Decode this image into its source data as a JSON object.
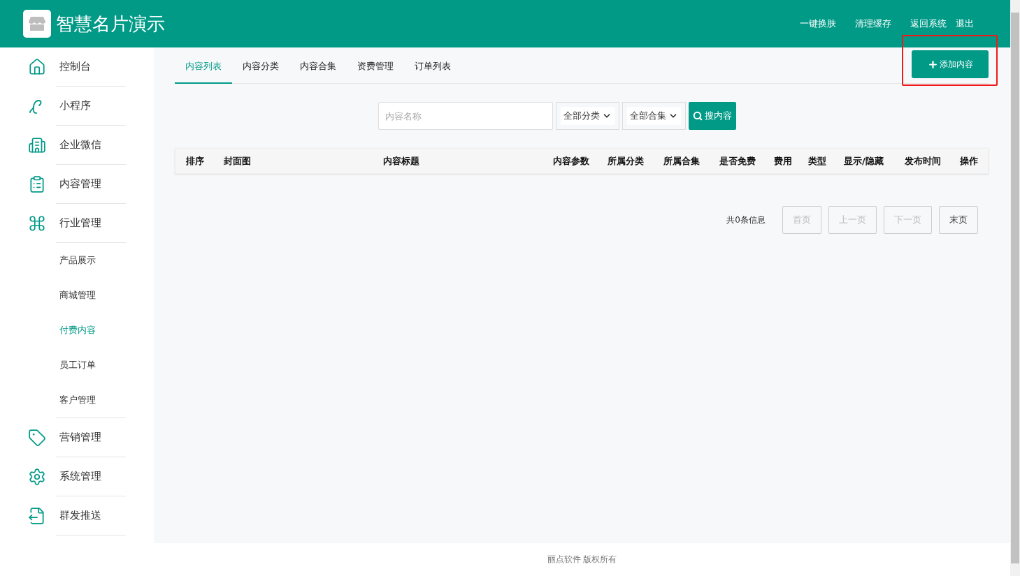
{
  "header": {
    "title": "智慧名片演示",
    "links": [
      "一键换肤",
      "清理缓存",
      "返回系统",
      "退出"
    ]
  },
  "sidebar": {
    "items": [
      {
        "label": "控制台",
        "selected": false
      },
      {
        "label": "小程序",
        "selected": false
      },
      {
        "label": "企业微信",
        "selected": false
      },
      {
        "label": "内容管理",
        "selected": false
      },
      {
        "label": "行业管理",
        "selected": false,
        "children": [
          {
            "label": "产品展示",
            "selected": false
          },
          {
            "label": "商城管理",
            "selected": false
          },
          {
            "label": "付费内容",
            "selected": true
          },
          {
            "label": "员工订单",
            "selected": false
          },
          {
            "label": "客户管理",
            "selected": false
          }
        ]
      },
      {
        "label": "营销管理",
        "selected": false
      },
      {
        "label": "系统管理",
        "selected": false
      },
      {
        "label": "群发推送",
        "selected": false
      }
    ]
  },
  "tabs": [
    {
      "label": "内容列表",
      "selected": true
    },
    {
      "label": "内容分类",
      "selected": false
    },
    {
      "label": "内容合集",
      "selected": false
    },
    {
      "label": "资费管理",
      "selected": false
    },
    {
      "label": "订单列表",
      "selected": false
    }
  ],
  "add_button": {
    "label": "添加内容",
    "highlighted": true
  },
  "search": {
    "placeholder": "内容名称",
    "category": "全部分类",
    "collection": "全部合集",
    "button": "搜内容"
  },
  "table": {
    "columns": [
      "排序",
      "封面图",
      "内容标题",
      "内容参数",
      "所属分类",
      "所属合集",
      "是否免费",
      "费用",
      "类型",
      "显示/隐藏",
      "发布时间",
      "操作"
    ]
  },
  "pagination": {
    "total": "共0条信息",
    "buttons": [
      {
        "label": "首页",
        "disabled": true
      },
      {
        "label": "上一页",
        "disabled": true
      },
      {
        "label": "下一页",
        "disabled": true
      },
      {
        "label": "末页",
        "disabled": false
      }
    ]
  },
  "footer": "丽点软件 版权所有"
}
